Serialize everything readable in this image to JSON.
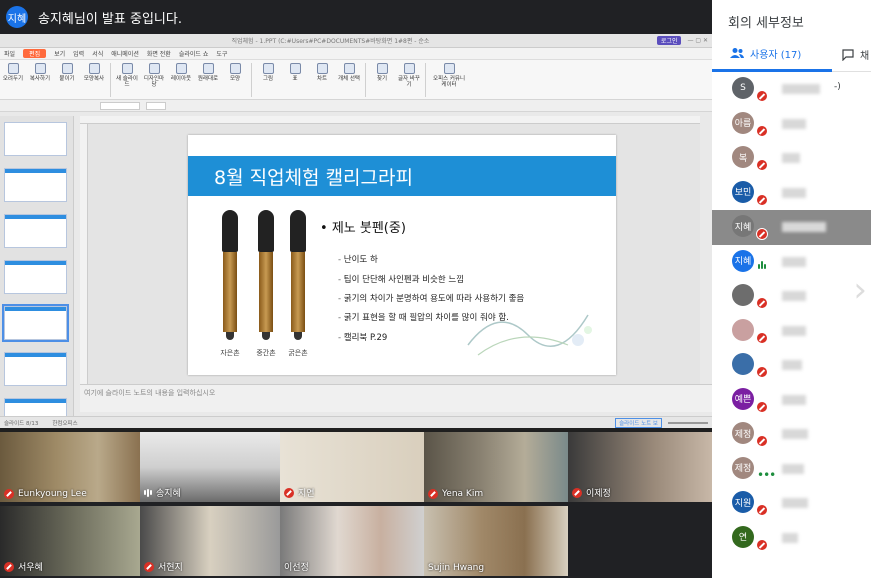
{
  "presenter": {
    "avatar": "지혜",
    "message": "송지혜님이 발표 중입니다."
  },
  "app": {
    "doc_title": "직업체험 - 1.PPT (C:#Users#PC#DOCUMENTS#바탕화면 1#8편 - 순소",
    "login_label": "로그인",
    "menu": [
      "파일",
      "편집",
      "보기",
      "입력",
      "서식",
      "애니메이션",
      "화면 전환",
      "슬라이드 쇼",
      "도구"
    ],
    "active_menu": "편집",
    "ribbon": [
      "오려두기",
      "복사하기",
      "붙이기",
      "모양복사",
      "새 슬라이드",
      "디자인마당",
      "레이아웃",
      "원래대로",
      "모양",
      "그림",
      "표",
      "차트",
      "개체 선택",
      "찾기",
      "글자 바꾸기",
      "오피스 커뮤니케이터"
    ]
  },
  "slide": {
    "title": "8월 직업체험 캘리그라피",
    "bullet": "제노 붓펜(중)",
    "items": [
      "난이도 하",
      "팁이 단단해 사인펜과 비슷한 느낌",
      "굵기의 차이가 분명하여 용도에 따라 사용하기 좋음",
      "굵기 표현을 할 때 필압의 차이를 많이 줘야 함.",
      "캘리북 P.29"
    ],
    "pen_labels": [
      "자은촌",
      "중간촌",
      "굵은촌"
    ]
  },
  "notes_placeholder": "여기에 슬라이드 노트의 내용을 입력하십시오",
  "status": {
    "slide": "슬라이드 8/13",
    "theme": "한컴오피스",
    "notes_button": "슬라이드 노트 보"
  },
  "tiles": [
    {
      "name": "Eunkyoung Lee",
      "muted": true
    },
    {
      "name": "송지혜",
      "muted": false
    },
    {
      "name": "지연",
      "muted": true
    },
    {
      "name": "Yena Kim",
      "muted": true
    },
    {
      "name": "이제정",
      "muted": true
    },
    {
      "name": "서우혜",
      "muted": true
    },
    {
      "name": "서현지",
      "muted": true
    },
    {
      "name": "이선정",
      "muted": false
    },
    {
      "name": "Sujin Hwang",
      "muted": false
    }
  ],
  "sidebar": {
    "title": "회의 세부정보",
    "people_tab": "사용자 (17)",
    "chat_tab": "채",
    "participants": [
      {
        "avatar": "S",
        "color": "#5f6368",
        "state": "muted",
        "suffix": "-)"
      },
      {
        "avatar": "아름",
        "color": "#a1887f",
        "state": "muted",
        "suffix": ""
      },
      {
        "avatar": "복",
        "color": "#a1887f",
        "state": "muted",
        "suffix": ""
      },
      {
        "avatar": "보민",
        "color": "#1a5ca8",
        "state": "muted",
        "suffix": ""
      },
      {
        "avatar": "지혜",
        "color": "#777777",
        "state": "muted-hl",
        "suffix": ""
      },
      {
        "avatar": "지혜",
        "color": "#1a73e8",
        "state": "speaking",
        "suffix": ""
      },
      {
        "avatar": "",
        "color": "#6d6d6d",
        "state": "muted",
        "suffix": ""
      },
      {
        "avatar": "",
        "color": "#c9a0a0",
        "state": "muted",
        "suffix": ""
      },
      {
        "avatar": "",
        "color": "#3a6ea8",
        "state": "muted",
        "suffix": ""
      },
      {
        "avatar": "예쁜",
        "color": "#7b1fa2",
        "state": "muted",
        "suffix": ""
      },
      {
        "avatar": "제정",
        "color": "#a1887f",
        "state": "muted",
        "suffix": ""
      },
      {
        "avatar": "제정",
        "color": "#a1887f",
        "state": "dots",
        "suffix": ""
      },
      {
        "avatar": "지원",
        "color": "#1a5ca8",
        "state": "muted",
        "suffix": ""
      },
      {
        "avatar": "연",
        "color": "#33691e",
        "state": "muted",
        "suffix": ""
      }
    ]
  }
}
